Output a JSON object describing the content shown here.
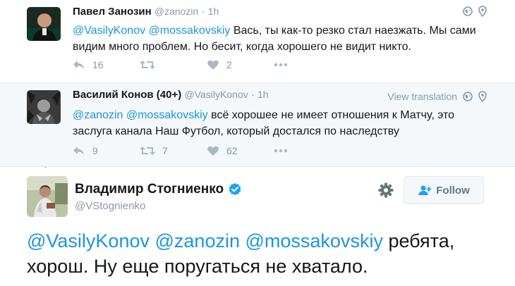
{
  "tweets": [
    {
      "name": "Павел Занозин",
      "handle": "@zanozin",
      "separator": "·",
      "time": "1h",
      "mention1": "@VasilyKonov",
      "mention2": "@mossakovskiy",
      "text": " Вась, ты как-то резко стал наезжать. Мы сами видим много проблем. Но бесит, когда хорошего не видит никто.",
      "reply_count": "16",
      "retweet_count": "",
      "like_count": "2"
    },
    {
      "name": "Василий Конов (40+)",
      "handle": "@VasilyKonov",
      "separator": "·",
      "time": "1h",
      "view_translation": "View translation",
      "mention1": "@zanozin",
      "mention2": "@mossakovskiy",
      "text": " всё хорошее не имеет отношения к Матчу, это заслуга канала Наш Футбол, который достался по наследству",
      "reply_count": "9",
      "retweet_count": "7",
      "like_count": "62"
    }
  ],
  "main": {
    "name": "Владимир Стогниенко",
    "handle": "@VStognienko",
    "follow_label": "Follow",
    "mention1": "@VasilyKonov",
    "mention2": "@zanozin",
    "mention3": "@mossakovskiy",
    "text": " ребята, хорош. Ну еще поругаться не хватало."
  },
  "colors": {
    "link": "#1b95e0",
    "thread_line": "#9fd2f2",
    "muted": "#8899a6",
    "verified": "#1da1f2"
  },
  "icons": [
    "globe-icon",
    "location-pin-icon",
    "reply-icon",
    "retweet-icon",
    "heart-icon",
    "more-icon",
    "verified-icon",
    "gear-icon",
    "follow-person-icon"
  ]
}
